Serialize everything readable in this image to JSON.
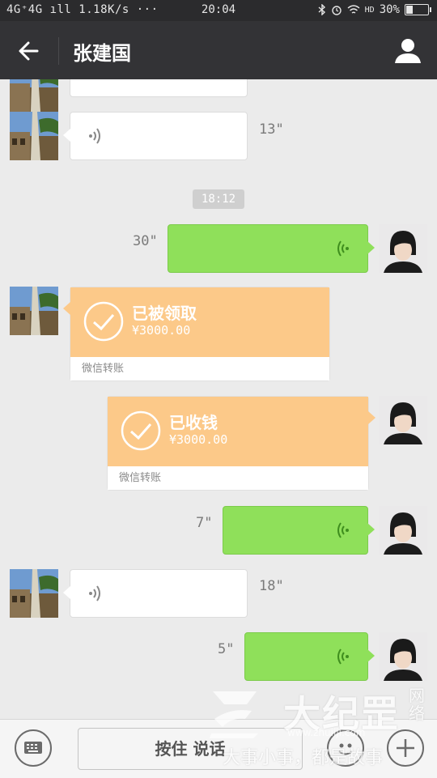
{
  "status_bar": {
    "network": "4G⁺4G ıll",
    "speed": "1.18K/s",
    "more": "···",
    "time": "20:04",
    "icons": [
      "bluetooth-icon",
      "alarm-icon",
      "wifi-icon",
      "hd-icon"
    ],
    "hd": "HD",
    "battery_percent": "30%",
    "battery_level": 0.3
  },
  "header": {
    "back_icon": "arrow-left-icon",
    "title": "张建国",
    "profile_icon": "person-icon"
  },
  "chat": {
    "timestamp": "18:12",
    "messages": [
      {
        "type": "voice",
        "side": "left",
        "duration": "13\""
      },
      {
        "type": "voice",
        "side": "right",
        "duration": "30\""
      },
      {
        "type": "transfer",
        "side": "left",
        "status": "已被领取",
        "amount": "¥3000.00",
        "label": "微信转账"
      },
      {
        "type": "transfer",
        "side": "right",
        "status": "已收钱",
        "amount": "¥3000.00",
        "label": "微信转账"
      },
      {
        "type": "voice",
        "side": "right",
        "duration": "7\""
      },
      {
        "type": "voice",
        "side": "left",
        "duration": "18\""
      },
      {
        "type": "voice",
        "side": "right",
        "duration": "5\""
      }
    ]
  },
  "bottom_bar": {
    "keyboard_icon": "keyboard-icon",
    "hold_to_talk": "按住 说话",
    "emoji_icon": "emoji-icon",
    "plus_icon": "plus-icon"
  },
  "watermark": {
    "brand": "大纪罡",
    "net": "网络",
    "url": "www.zhuiiji.com",
    "slogan": "大事小事，都是故事"
  },
  "colors": {
    "nav_bg": "#333336",
    "chat_bg": "#ebebeb",
    "green_bubble": "#8fe05a",
    "transfer_orange": "#fcc989"
  }
}
